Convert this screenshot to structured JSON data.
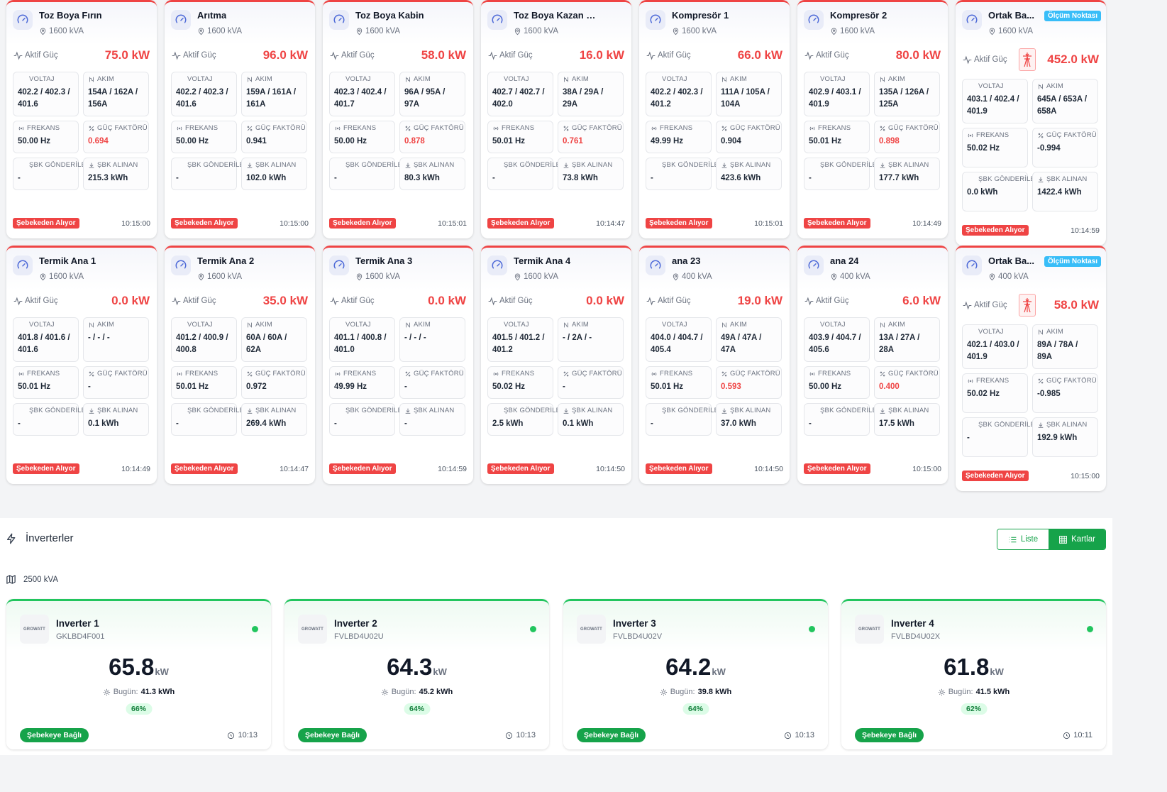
{
  "labels": {
    "active_power": "Aktif Güç",
    "voltage": "VOLTAJ",
    "current": "AKIM",
    "frequency": "FREKANS",
    "power_factor": "GÜÇ FAKTÖRÜ",
    "grid_sent": "ŞBK GÖNDERİLEN",
    "grid_received": "ŞBK ALINAN",
    "measure_point": "Ölçüm Noktası",
    "status_grid": "Şebekeden Alıyor",
    "today": "Bugün:",
    "grid_connected": "Şebekeye Bağlı"
  },
  "colors": {
    "alert_red": "#ef4444",
    "ok_green": "#16a34a",
    "info_blue": "#38bdf8"
  },
  "meters": [
    {
      "name": "Toz Boya Fırın",
      "kva": "1600 kVA",
      "power": "75.0 kW",
      "voltage": "402.2 / 402.3 / 401.6",
      "current": "154A / 162A / 156A",
      "frequency": "50.00 Hz",
      "pf": "0.694",
      "pf_alert": true,
      "sent": "-",
      "received": "215.3 kWh",
      "time": "10:15:00",
      "measure_point": false
    },
    {
      "name": "Arıtma",
      "kva": "1600 kVA",
      "power": "96.0 kW",
      "voltage": "402.2 / 402.3 / 401.6",
      "current": "159A / 161A / 161A",
      "frequency": "50.00 Hz",
      "pf": "0.941",
      "pf_alert": false,
      "sent": "-",
      "received": "102.0 kWh",
      "time": "10:15:00",
      "measure_point": false
    },
    {
      "name": "Toz Boya Kabin",
      "kva": "1600 kVA",
      "power": "58.0 kW",
      "voltage": "402.3 / 402.4 / 401.7",
      "current": "96A / 95A / 97A",
      "frequency": "50.00 Hz",
      "pf": "0.878",
      "pf_alert": true,
      "sent": "-",
      "received": "80.3 kWh",
      "time": "10:15:01",
      "measure_point": false
    },
    {
      "name": "Toz Boya Kazan - Chiller",
      "kva": "1600 kVA",
      "power": "16.0 kW",
      "voltage": "402.7 / 402.7 / 402.0",
      "current": "38A / 29A / 29A",
      "frequency": "50.01 Hz",
      "pf": "0.761",
      "pf_alert": true,
      "sent": "-",
      "received": "73.8 kWh",
      "time": "10:14:47",
      "measure_point": false
    },
    {
      "name": "Kompresör 1",
      "kva": "1600 kVA",
      "power": "66.0 kW",
      "voltage": "402.2 / 402.3 / 401.2",
      "current": "111A / 105A / 104A",
      "frequency": "49.99 Hz",
      "pf": "0.904",
      "pf_alert": false,
      "sent": "-",
      "received": "423.6 kWh",
      "time": "10:15:01",
      "measure_point": false
    },
    {
      "name": "Kompresör 2",
      "kva": "1600 kVA",
      "power": "80.0 kW",
      "voltage": "402.9 / 403.1 / 401.9",
      "current": "135A / 126A / 125A",
      "frequency": "50.01 Hz",
      "pf": "0.898",
      "pf_alert": true,
      "sent": "-",
      "received": "177.7 kWh",
      "time": "10:14:49",
      "measure_point": false
    },
    {
      "name": "Ortak Ba...",
      "kva": "1600 kVA",
      "power": "452.0 kW",
      "voltage": "403.1 / 402.4 / 401.9",
      "current": "645A / 653A / 658A",
      "frequency": "50.02 Hz",
      "pf": "-0.994",
      "pf_alert": false,
      "sent": "0.0 kWh",
      "received": "1422.4 kWh",
      "time": "10:14:59",
      "measure_point": true
    },
    {
      "name": "Termik Ana 1",
      "kva": "1600 kVA",
      "power": "0.0 kW",
      "voltage": "401.8 / 401.6 / 401.6",
      "current": "- / - / -",
      "frequency": "50.01 Hz",
      "pf": "-",
      "pf_alert": false,
      "sent": "-",
      "received": "0.1 kWh",
      "time": "10:14:49",
      "measure_point": false
    },
    {
      "name": "Termik Ana 2",
      "kva": "1600 kVA",
      "power": "35.0 kW",
      "voltage": "401.2 / 400.9 / 400.8",
      "current": "60A / 60A / 62A",
      "frequency": "50.01 Hz",
      "pf": "0.972",
      "pf_alert": false,
      "sent": "-",
      "received": "269.4 kWh",
      "time": "10:14:47",
      "measure_point": false
    },
    {
      "name": "Termik Ana 3",
      "kva": "1600 kVA",
      "power": "0.0 kW",
      "voltage": "401.1 / 400.8 / 401.0",
      "current": "- / - / -",
      "frequency": "49.99 Hz",
      "pf": "-",
      "pf_alert": false,
      "sent": "-",
      "received": "-",
      "time": "10:14:59",
      "measure_point": false
    },
    {
      "name": "Termik Ana 4",
      "kva": "1600 kVA",
      "power": "0.0 kW",
      "voltage": "401.5 / 401.2 / 401.2",
      "current": "- / 2A / -",
      "frequency": "50.02 Hz",
      "pf": "-",
      "pf_alert": false,
      "sent": "2.5 kWh",
      "received": "0.1 kWh",
      "time": "10:14:50",
      "measure_point": false
    },
    {
      "name": "ana 23",
      "kva": "400 kVA",
      "power": "19.0 kW",
      "voltage": "404.0 / 404.7 / 405.4",
      "current": "49A / 47A / 47A",
      "frequency": "50.01 Hz",
      "pf": "0.593",
      "pf_alert": true,
      "sent": "-",
      "received": "37.0 kWh",
      "time": "10:14:50",
      "measure_point": false
    },
    {
      "name": "ana 24",
      "kva": "400 kVA",
      "power": "6.0 kW",
      "voltage": "403.9 / 404.7 / 405.6",
      "current": "13A / 27A / 28A",
      "frequency": "50.00 Hz",
      "pf": "0.400",
      "pf_alert": true,
      "sent": "-",
      "received": "17.5 kWh",
      "time": "10:15:00",
      "measure_point": false
    },
    {
      "name": "Ortak Ba...",
      "kva": "400 kVA",
      "power": "58.0 kW",
      "voltage": "402.1 / 403.0 / 401.9",
      "current": "89A / 78A / 89A",
      "frequency": "50.02 Hz",
      "pf": "-0.985",
      "pf_alert": false,
      "sent": "-",
      "received": "192.9 kWh",
      "time": "10:15:00",
      "measure_point": true
    }
  ],
  "inverters_section": {
    "title": "İnverterler",
    "view_list": "Liste",
    "view_cards": "Kartlar",
    "capacity": "2500 kVA",
    "brand_logo_text": "GROWATT"
  },
  "inverters": [
    {
      "name": "Inverter 1",
      "serial": "GKLBD4F001",
      "power": "65.8",
      "unit": "kW",
      "today": "41.3 kWh",
      "percent": "66%",
      "percent_value": 66,
      "time": "10:13"
    },
    {
      "name": "Inverter 2",
      "serial": "FVLBD4U02U",
      "power": "64.3",
      "unit": "kW",
      "today": "45.2 kWh",
      "percent": "64%",
      "percent_value": 64,
      "time": "10:13"
    },
    {
      "name": "Inverter 3",
      "serial": "FVLBD4U02V",
      "power": "64.2",
      "unit": "kW",
      "today": "39.8 kWh",
      "percent": "64%",
      "percent_value": 64,
      "time": "10:13"
    },
    {
      "name": "Inverter 4",
      "serial": "FVLBD4U02X",
      "power": "61.8",
      "unit": "kW",
      "today": "41.5 kWh",
      "percent": "62%",
      "percent_value": 62,
      "time": "10:11"
    }
  ]
}
